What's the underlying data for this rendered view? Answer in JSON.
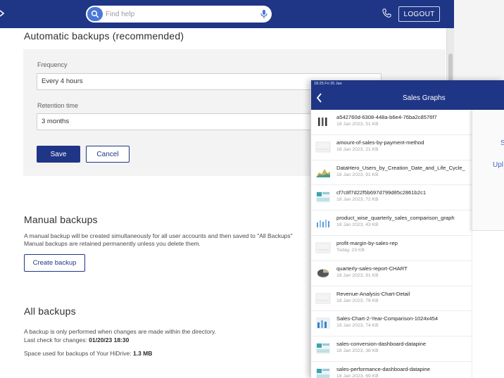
{
  "header": {
    "search_placeholder": "Find help",
    "logout_label": "LOGOUT"
  },
  "auto_backups": {
    "title": "Automatic backups (recommended)",
    "frequency_label": "Frequency",
    "frequency_value": "Every 4 hours",
    "retention_label": "Retention time",
    "retention_value": "3 months",
    "save_label": "Save",
    "cancel_label": "Cancel"
  },
  "manual_backups": {
    "title": "Manual backups",
    "desc_line1": "A manual backup will be created simultaneously for all user accounts and then saved to \"All Backups\"",
    "desc_line2": "Manual backups are retained permanently unless you delete them.",
    "create_label": "Create backup"
  },
  "all_backups": {
    "title": "All backups",
    "line1": "A backup is only performed when changes are made within the directory.",
    "last_check_label": "Last check for changes:",
    "last_check_value": "01/20/23 18:30",
    "space_label": "Space used for backups of Your HiDrive:",
    "space_value": "1.3 MB"
  },
  "tablet": {
    "status_time": "18:25  Fri 20 Jan",
    "title": "Sales Graphs",
    "side_items": [
      "S",
      "Upl"
    ],
    "files": [
      {
        "name": "a542760d-6308-448a-b6e4-76ba2c8576f7",
        "meta": "18 Jan 2023, 51 KB",
        "icon": "bar-thumb-icon"
      },
      {
        "name": "amount-of-sales-by-payment-method",
        "meta": "18 Jan 2023, 21 KB",
        "icon": "blank-thumb-icon"
      },
      {
        "name": "DataHero_Users_by_Creation_Date_and_Life_Cycle_",
        "meta": "18 Jan 2023, 91 KB",
        "icon": "area-thumb-icon"
      },
      {
        "name": "cf7c8f7d22f5b697d799d85c2861b2c1",
        "meta": "18 Jan 2023, 72 KB",
        "icon": "dashboard-thumb-icon"
      },
      {
        "name": "product_wise_quarterly_sales_comparison_graph",
        "meta": "18 Jan 2023, 43 KB",
        "icon": "column-thumb-icon"
      },
      {
        "name": "profit-margin-by-sales-rep",
        "meta": "Today, 23 KB",
        "icon": "blank-thumb-icon"
      },
      {
        "name": "quarterly-sales-report-CHART",
        "meta": "18 Jan 2023, 91 KB",
        "icon": "pie-thumb-icon"
      },
      {
        "name": "Revenue-Analysis-Chart-Detail",
        "meta": "18 Jan 2023, 76 KB",
        "icon": "blank-thumb-icon"
      },
      {
        "name": "Sales-Chart-2-Year-Comparison-1024x454",
        "meta": "18 Jan 2023, 74 KB",
        "icon": "comparison-thumb-icon"
      },
      {
        "name": "sales-conversion-dashboard-datapine",
        "meta": "18 Jan 2023, 38 KB",
        "icon": "dashboard-thumb-icon"
      },
      {
        "name": "sales-performance-dashboard-datapine",
        "meta": "18 Jan 2023, 69 KB",
        "icon": "dashboard-thumb-icon"
      }
    ]
  },
  "colors": {
    "brand_blue": "#1f3585",
    "accent_blue": "#4a78d6",
    "link_blue": "#3c66c8"
  }
}
